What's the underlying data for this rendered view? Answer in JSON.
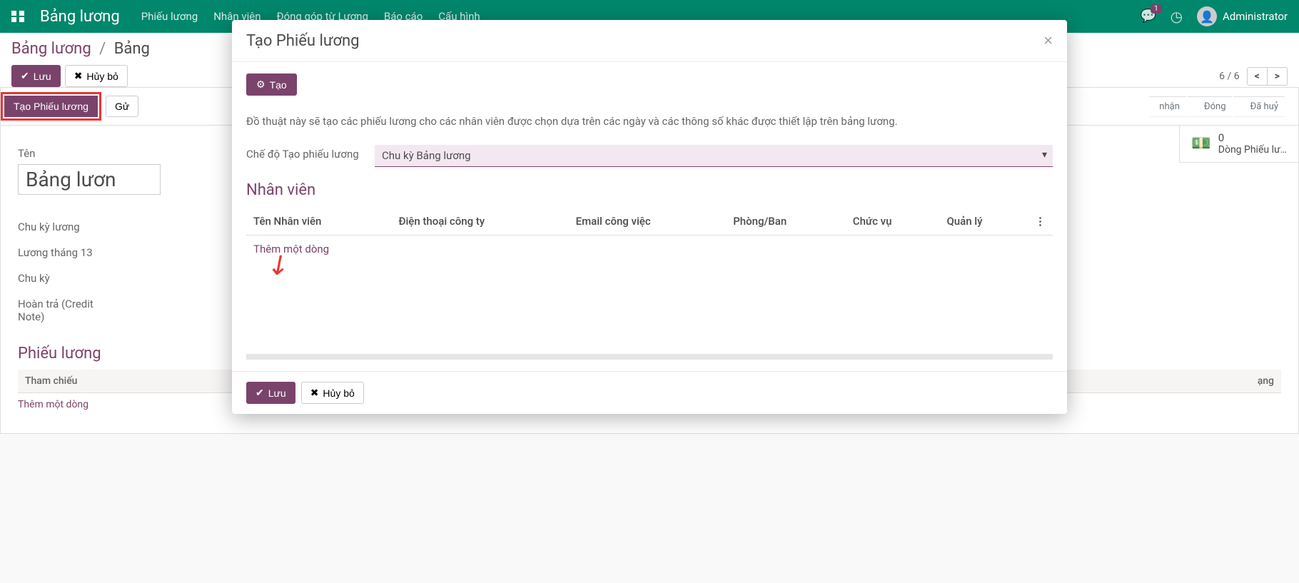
{
  "topnav": {
    "app_name": "Bảng lương",
    "menus": [
      "Phiếu lương",
      "Nhân viên",
      "Đóng góp từ Lương",
      "Báo cáo",
      "Cấu hình"
    ],
    "msg_count": "1",
    "user": "Administrator"
  },
  "breadcrumb": {
    "root": "Bảng lương",
    "current_truncated": "Bảng"
  },
  "controls": {
    "save": "Lưu",
    "discard": "Hủy bỏ",
    "pager": "6 / 6"
  },
  "button_bar": {
    "create_payslip": "Tạo Phiếu lương",
    "send_truncated": "Gử",
    "statuses": [
      "nhận",
      "Đóng",
      "Đã huỷ"
    ]
  },
  "statbox": {
    "count": "0",
    "label": "Dòng Phiếu lư…"
  },
  "form": {
    "name_label": "Tên",
    "name_value": "Bảng lươn",
    "rows": {
      "cycle": "Chu kỳ lương",
      "month13": "Lương tháng 13",
      "period": "Chu kỳ",
      "credit": "Hoàn trả (Credit Note)"
    },
    "section": "Phiếu lương",
    "table_headers": {
      "ref": "Tham chiếu",
      "status": "ạng"
    },
    "add_line": "Thêm một dòng"
  },
  "modal": {
    "title": "Tạo Phiếu lương",
    "create_btn": "Tạo",
    "description": "Đồ thuật này sẽ tạo các phiếu lương cho các nhân viên được chọn dựa trên các ngày và các thông số khác được thiết lập trên bảng lương.",
    "mode_label": "Chế độ Tạo phiếu lương",
    "mode_value": "Chu kỳ Bảng lương",
    "emp_section": "Nhân viên",
    "emp_headers": {
      "name": "Tên Nhân viên",
      "phone": "Điện thoại công ty",
      "email": "Email công việc",
      "dept": "Phòng/Ban",
      "pos": "Chức vụ",
      "mgr": "Quản lý"
    },
    "add_line": "Thêm một dòng",
    "footer_save": "Lưu",
    "footer_cancel": "Hủy bỏ"
  }
}
